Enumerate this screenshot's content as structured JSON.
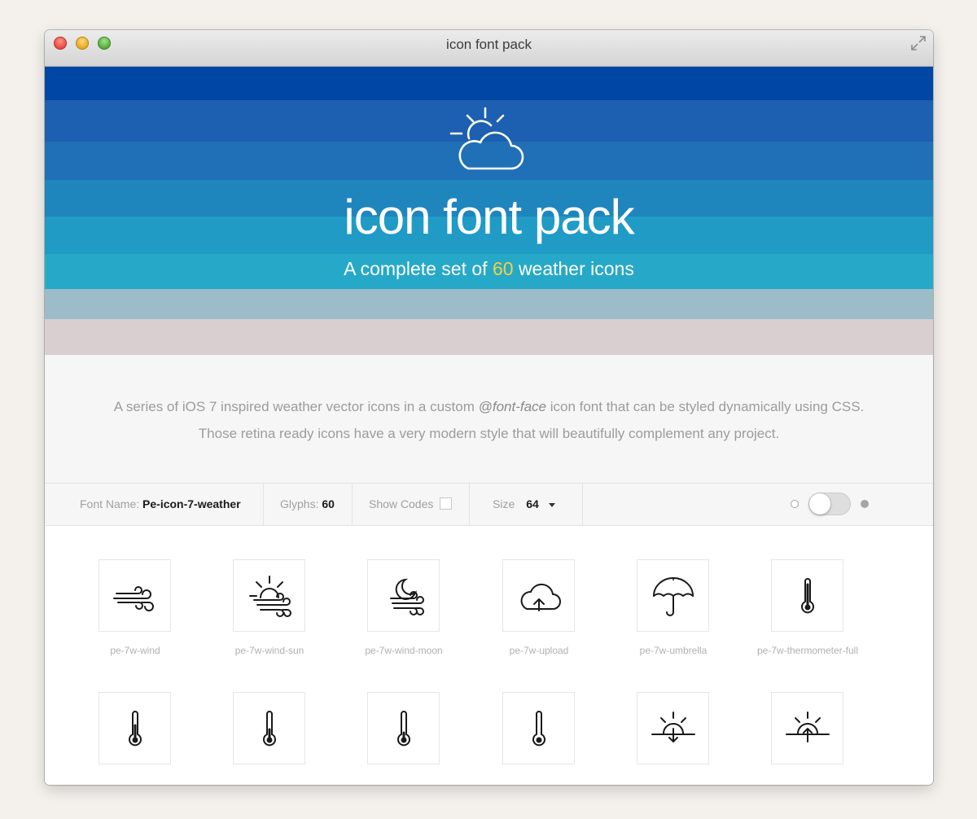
{
  "window": {
    "title": "icon font pack"
  },
  "hero": {
    "title": "icon font pack",
    "subtitle_pre": "A complete set of ",
    "subtitle_count": "60",
    "subtitle_post": " weather icons",
    "icon": "partly-cloudy-icon",
    "accent_color": "#f5d13c"
  },
  "bands": [
    {
      "color": "#0046a5"
    },
    {
      "color": "#1d5fb0"
    },
    {
      "color": "#2070b7"
    },
    {
      "color": "#1f85bd"
    },
    {
      "color": "#1f9bc6"
    },
    {
      "color": "#26a9c8"
    },
    {
      "color": "#9bbcc8"
    },
    {
      "color": "#d9cfd0"
    }
  ],
  "description": {
    "line1_pre": "A series of iOS 7 inspired weather vector icons in a custom ",
    "line1_em": "@font-face",
    "line1_post": " icon font that can be styled dynamically using CSS.",
    "line2": "Those retina ready icons have a very modern style that will beautifully complement any project."
  },
  "toolbar": {
    "font_name_label": "Font Name: ",
    "font_name_value": "Pe-icon-7-weather",
    "glyphs_label": "Glyphs: ",
    "glyphs_value": "60",
    "show_codes_label": "Show Codes",
    "show_codes_checked": false,
    "size_label": "Size",
    "size_value": "64",
    "dark_mode_on": false
  },
  "glyphs": [
    {
      "name": "pe-7w-wind",
      "icon": "wind-icon"
    },
    {
      "name": "pe-7w-wind-sun",
      "icon": "wind-sun-icon"
    },
    {
      "name": "pe-7w-wind-moon",
      "icon": "wind-moon-icon"
    },
    {
      "name": "pe-7w-upload",
      "icon": "cloud-upload-icon"
    },
    {
      "name": "pe-7w-umbrella",
      "icon": "umbrella-icon"
    },
    {
      "name": "pe-7w-thermometer-full",
      "icon": "thermometer-full-icon"
    },
    {
      "name": "",
      "icon": "thermometer-icon"
    },
    {
      "name": "",
      "icon": "thermometer-icon"
    },
    {
      "name": "",
      "icon": "thermometer-icon"
    },
    {
      "name": "",
      "icon": "thermometer-icon"
    },
    {
      "name": "",
      "icon": "sunset-icon"
    },
    {
      "name": "",
      "icon": "sunrise-icon"
    }
  ]
}
